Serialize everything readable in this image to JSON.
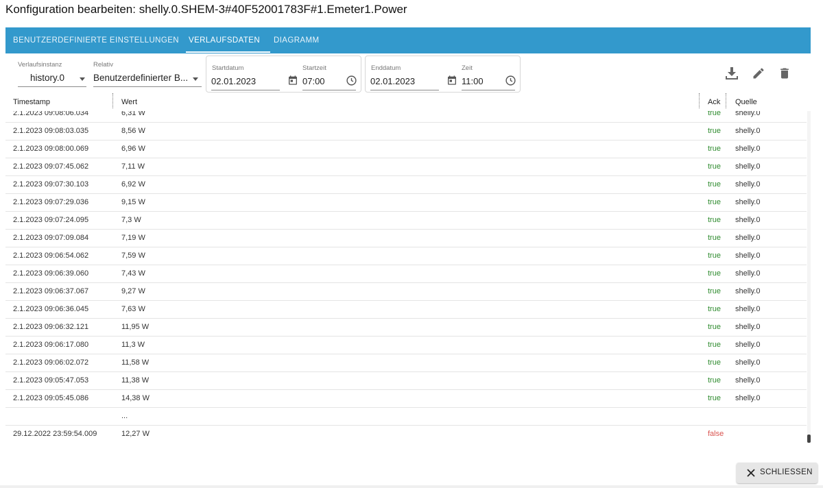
{
  "window": {
    "title": "Konfiguration bearbeiten: shelly.0.SHEM-3#40F52001783F#1.Emeter1.Power"
  },
  "tabs": [
    {
      "label": "BENUTZERDEFINIERTE EINSTELLUNGEN"
    },
    {
      "label": "VERLAUFSDATEN",
      "active": true
    },
    {
      "label": "DIAGRAMM"
    }
  ],
  "filters": {
    "instance": {
      "label": "Verlaufsinstanz",
      "value": "history.0"
    },
    "relative": {
      "label": "Relativ",
      "value": "Benutzerdefinierter B..."
    },
    "start": {
      "date_label": "Startdatum",
      "date_value": "02.01.2023",
      "time_label": "Startzeit",
      "time_value": "07:00"
    },
    "end": {
      "date_label": "Enddatum",
      "date_value": "02.01.2023",
      "time_label": "Zeit",
      "time_value": "11:00"
    }
  },
  "toolbar": {
    "icons": [
      "download-icon",
      "edit-icon",
      "delete-icon"
    ]
  },
  "table": {
    "columns": [
      "Timestamp",
      "Wert",
      "Ack",
      "Quelle"
    ],
    "rows": [
      {
        "ts": "2.1.2023 09:08:06.034",
        "val": "6,31 W",
        "ack": "true",
        "src": "shelly.0"
      },
      {
        "ts": "2.1.2023 09:08:03.035",
        "val": "8,56 W",
        "ack": "true",
        "src": "shelly.0"
      },
      {
        "ts": "2.1.2023 09:08:00.069",
        "val": "6,96 W",
        "ack": "true",
        "src": "shelly.0"
      },
      {
        "ts": "2.1.2023 09:07:45.062",
        "val": "7,11 W",
        "ack": "true",
        "src": "shelly.0"
      },
      {
        "ts": "2.1.2023 09:07:30.103",
        "val": "6,92 W",
        "ack": "true",
        "src": "shelly.0"
      },
      {
        "ts": "2.1.2023 09:07:29.036",
        "val": "9,15 W",
        "ack": "true",
        "src": "shelly.0"
      },
      {
        "ts": "2.1.2023 09:07:24.095",
        "val": "7,3 W",
        "ack": "true",
        "src": "shelly.0"
      },
      {
        "ts": "2.1.2023 09:07:09.084",
        "val": "7,19 W",
        "ack": "true",
        "src": "shelly.0"
      },
      {
        "ts": "2.1.2023 09:06:54.062",
        "val": "7,59 W",
        "ack": "true",
        "src": "shelly.0"
      },
      {
        "ts": "2.1.2023 09:06:39.060",
        "val": "7,43 W",
        "ack": "true",
        "src": "shelly.0"
      },
      {
        "ts": "2.1.2023 09:06:37.067",
        "val": "9,27 W",
        "ack": "true",
        "src": "shelly.0"
      },
      {
        "ts": "2.1.2023 09:06:36.045",
        "val": "7,63 W",
        "ack": "true",
        "src": "shelly.0"
      },
      {
        "ts": "2.1.2023 09:06:32.121",
        "val": "11,95 W",
        "ack": "true",
        "src": "shelly.0"
      },
      {
        "ts": "2.1.2023 09:06:17.080",
        "val": "11,3 W",
        "ack": "true",
        "src": "shelly.0"
      },
      {
        "ts": "2.1.2023 09:06:02.072",
        "val": "11,58 W",
        "ack": "true",
        "src": "shelly.0"
      },
      {
        "ts": "2.1.2023 09:05:47.053",
        "val": "11,38 W",
        "ack": "true",
        "src": "shelly.0"
      },
      {
        "ts": "2.1.2023 09:05:45.086",
        "val": "14,38 W",
        "ack": "true",
        "src": "shelly.0"
      },
      {
        "ts": "",
        "val": "...",
        "ack": "",
        "src": ""
      },
      {
        "ts": "29.12.2022 23:59:54.009",
        "val": "12,27 W",
        "ack": "false",
        "src": ""
      }
    ]
  },
  "footer": {
    "close_label": "SCHLIESSEN"
  },
  "colors": {
    "tab_bar": "#3399cc",
    "ack_true": "#2e8b2e",
    "ack_false": "#d9534f"
  }
}
